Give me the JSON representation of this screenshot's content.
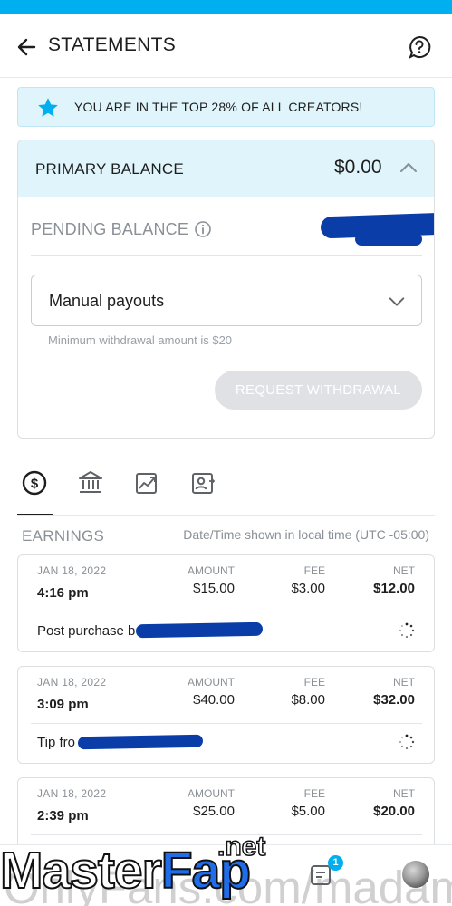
{
  "header": {
    "title": "STATEMENTS"
  },
  "banner": {
    "text": "YOU ARE IN THE TOP 28% OF ALL CREATORS!"
  },
  "balance": {
    "primary_label": "PRIMARY BALANCE",
    "primary_amount": "$0.00",
    "pending_label": "PENDING BALANCE",
    "payout_method": "Manual payouts",
    "min_note": "Minimum withdrawal amount is $20",
    "withdraw_label": "REQUEST WITHDRAWAL"
  },
  "tabs": [
    {
      "icon": "dollar-circle-icon"
    },
    {
      "icon": "bank-icon"
    },
    {
      "icon": "chart-icon"
    },
    {
      "icon": "profile-card-icon"
    }
  ],
  "earnings": {
    "label": "EARNINGS",
    "tz_note": "Date/Time shown in local time (UTC -05:00)",
    "col_amount": "AMOUNT",
    "col_fee": "FEE",
    "col_net": "NET",
    "rows": [
      {
        "date": "JAN 18, 2022",
        "time": "4:16 pm",
        "amount": "$15.00",
        "fee": "$3.00",
        "net": "$12.00",
        "desc": "Post purchase b"
      },
      {
        "date": "JAN 18, 2022",
        "time": "3:09 pm",
        "amount": "$40.00",
        "fee": "$8.00",
        "net": "$32.00",
        "desc": "Tip fro"
      },
      {
        "date": "JAN 18, 2022",
        "time": "2:39 pm",
        "amount": "$25.00",
        "fee": "$5.00",
        "net": "$20.00",
        "desc": ""
      }
    ]
  },
  "footer": {
    "chat_badge": "1"
  },
  "watermark": {
    "main": "Master",
    "brand": "Fap",
    "tld": ".net",
    "url": "OnlyFans.com/madam_mula"
  },
  "colors": {
    "accent": "#00aff0",
    "banner_bg": "#dff4fb",
    "redaction": "#0a3da8"
  }
}
